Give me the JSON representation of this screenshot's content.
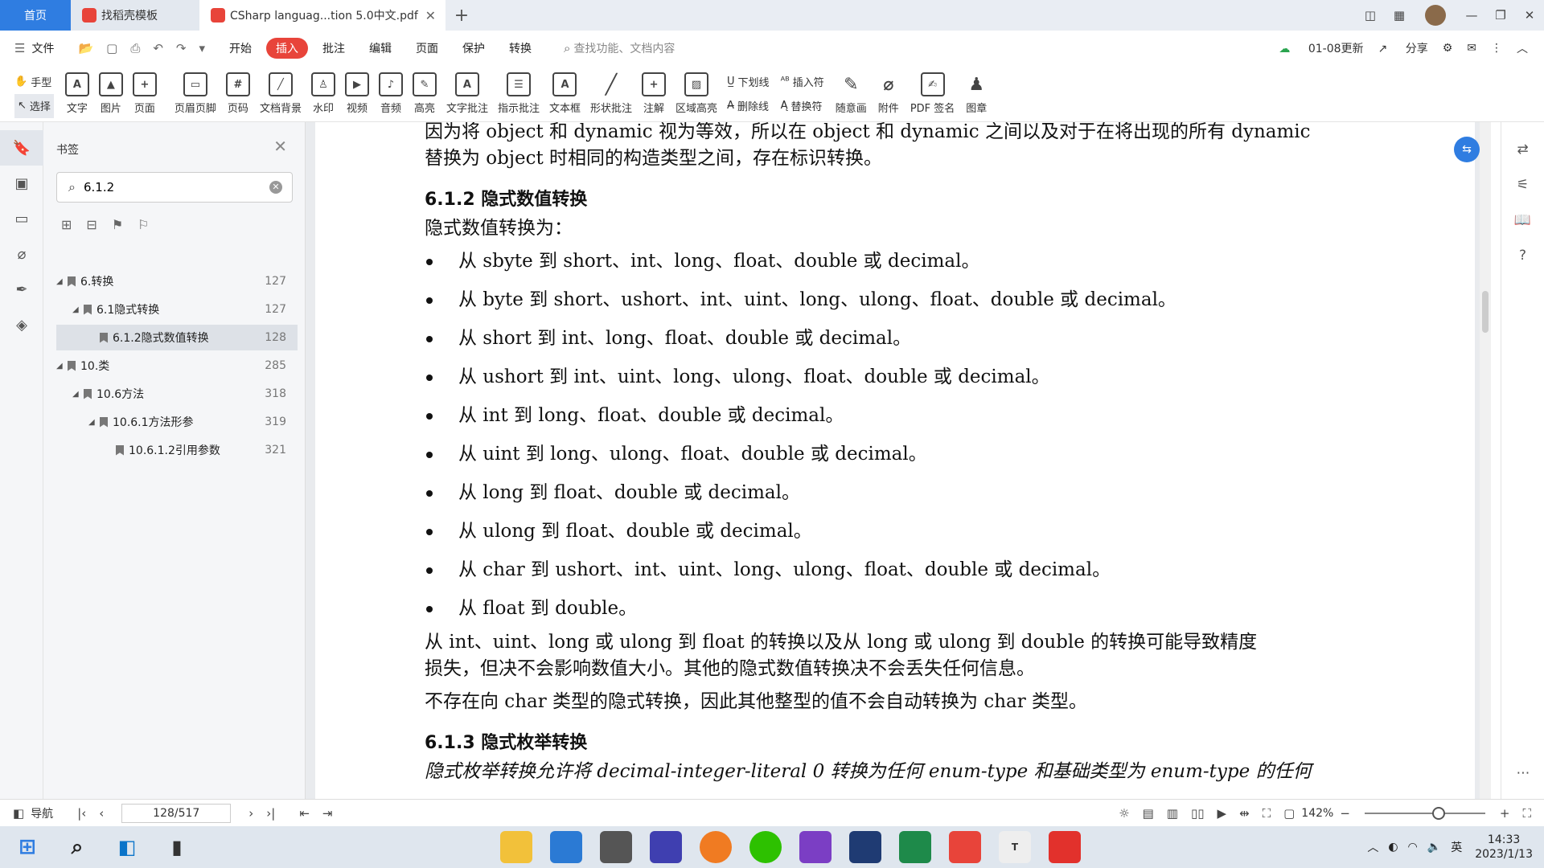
{
  "tabs": {
    "home": "首页",
    "template": "找稻壳模板",
    "doc": "CSharp languag...tion 5.0中文.pdf"
  },
  "menu": {
    "file": "文件",
    "items": [
      "开始",
      "插入",
      "批注",
      "编辑",
      "页面",
      "保护",
      "转换"
    ],
    "active_index": 1,
    "search_placeholder": "查找功能、文档内容",
    "update": "01-08更新",
    "share": "分享"
  },
  "toolbar": {
    "hand": "手型",
    "select": "选择",
    "text": "文字",
    "image": "图片",
    "page": "页面",
    "header_footer": "页眉页脚",
    "page_num": "页码",
    "background": "文档背景",
    "watermark": "水印",
    "video": "视频",
    "audio": "音频",
    "highlight": "高亮",
    "text_comment": "文字批注",
    "pointer_comment": "指示批注",
    "textbox": "文本框",
    "shape_comment": "形状批注",
    "annotation": "注解",
    "area_highlight": "区域高亮",
    "underline": "下划线",
    "strikethrough": "删除线",
    "insert_char": "插入符",
    "replace_char": "替换符",
    "freehand": "随意画",
    "attachment": "附件",
    "pdf_sign": "PDF 签名",
    "stamp": "图章"
  },
  "sidebar": {
    "title": "书签",
    "search_value": "6.1.2",
    "bookmarks": [
      {
        "label": "6.转换",
        "page": "127",
        "level": 0,
        "selected": false
      },
      {
        "label": "6.1隐式转换",
        "page": "127",
        "level": 1,
        "selected": false
      },
      {
        "label": "6.1.2隐式数值转换",
        "page": "128",
        "level": 2,
        "selected": true
      },
      {
        "label": "10.类",
        "page": "285",
        "level": 0,
        "selected": false
      },
      {
        "label": "10.6方法",
        "page": "318",
        "level": 1,
        "selected": false
      },
      {
        "label": "10.6.1方法形参",
        "page": "319",
        "level": 2,
        "selected": false
      },
      {
        "label": "10.6.1.2引用参数",
        "page": "321",
        "level": 3,
        "selected": false
      }
    ]
  },
  "document": {
    "top_line1": "因为将 object 和 dynamic 视为等效，所以在 object 和 dynamic 之间以及对于在将出现的所有 dynamic",
    "top_line2": "替换为 object 时相同的构造类型之间，存在标识转换。",
    "heading1": "6.1.2 隐式数值转换",
    "intro": "隐式数值转换为：",
    "bullets": [
      "从 sbyte 到 short、int、long、float、double 或 decimal。",
      "从 byte 到 short、ushort、int、uint、long、ulong、float、double 或 decimal。",
      "从 short 到 int、long、float、double 或 decimal。",
      "从 ushort 到 int、uint、long、ulong、float、double 或 decimal。",
      "从 int 到 long、float、double 或 decimal。",
      "从 uint 到 long、ulong、float、double 或 decimal。",
      "从 long 到 float、double 或 decimal。",
      "从 ulong 到 float、double 或 decimal。",
      "从 char 到 ushort、int、uint、long、ulong、float、double 或 decimal。",
      "从 float 到 double。"
    ],
    "para1_line1": "从 int、uint、long 或 ulong 到 float 的转换以及从 long 或 ulong 到 double 的转换可能导致精度",
    "para1_line2": "损失，但决不会影响数值大小。其他的隐式数值转换决不会丢失任何信息。",
    "para2": "不存在向 char 类型的隐式转换，因此其他整型的值不会自动转换为 char 类型。",
    "heading2": "6.1.3 隐式枚举转换",
    "cut_line": "隐式枚举转换允许将 decimal-integer-literal 0 转换为任何 enum-type 和基础类型为 enum-type 的任何"
  },
  "status": {
    "nav": "导航",
    "page": "128/517",
    "zoom": "142%"
  },
  "taskbar": {
    "time": "14:33",
    "date": "2023/1/13",
    "ime": "英"
  },
  "colors": {
    "accent": "#2f7de1",
    "active_menu": "#e8443a"
  }
}
